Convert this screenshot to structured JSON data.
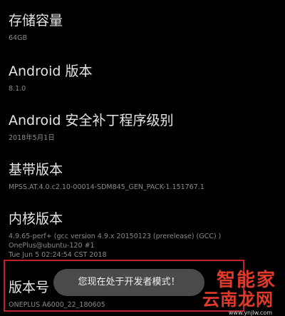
{
  "settings": {
    "storage": {
      "title": "存储容量",
      "value": "64GB"
    },
    "android_version": {
      "title": "Android 版本",
      "value": "8.1.0"
    },
    "security_patch": {
      "title": "Android 安全补丁程序级别",
      "value": "2018年5月1日"
    },
    "baseband": {
      "title": "基带版本",
      "value": "MPSS.AT.4.0.c2.10-00014-SDM845_GEN_PACK-1.151767.1"
    },
    "kernel": {
      "title": "内核版本",
      "lines": [
        "4.9.65-perf+ (gcc version 4.9.x 20150123 (prerelease) (GCC) )",
        "OnePlus@ubuntu-120 #1",
        "Tue Jun 5 02:24:54 CST 2018"
      ]
    },
    "build_number": {
      "title": "版本号",
      "value": "ONEPLUS A6000_22_180605"
    }
  },
  "toast": {
    "message": "您现在处于开发者模式！"
  },
  "watermark": {
    "line1": "智能家",
    "line2": "云南龙网",
    "url": "www.ynjlw.com"
  },
  "colors": {
    "highlight_border": "#c0202a",
    "watermark_red": "#e03a2a",
    "toast_bg": "#4a4a4a"
  }
}
